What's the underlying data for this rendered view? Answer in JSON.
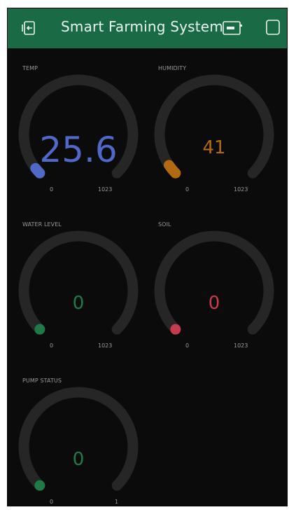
{
  "header": {
    "title": "Smart Farming System",
    "bg_color": "#1a6b45",
    "left_icon": "device-selector-icon",
    "mid_icon": "device-status-icon",
    "right_icon": "widget-box-icon"
  },
  "widgets": [
    {
      "label": "TEMP",
      "value": "25.6",
      "min": "0",
      "max": "1023",
      "level": 0.025,
      "color": "#5068c8"
    },
    {
      "label": "HUMIDITY",
      "value": "41",
      "min": "0",
      "max": "1023",
      "level": 0.04,
      "color": "#b26a12"
    },
    {
      "label": "WATER LEVEL",
      "value": "0",
      "min": "0",
      "max": "1023",
      "level": 0,
      "color": "#1f7a45"
    },
    {
      "label": "SOIL",
      "value": "0",
      "min": "0",
      "max": "1023",
      "level": 0,
      "color": "#c43c4e"
    },
    {
      "label": "PUMP STATUS",
      "value": "0",
      "min": "0",
      "max": "1",
      "level": 0,
      "color": "#1f7a45"
    }
  ]
}
